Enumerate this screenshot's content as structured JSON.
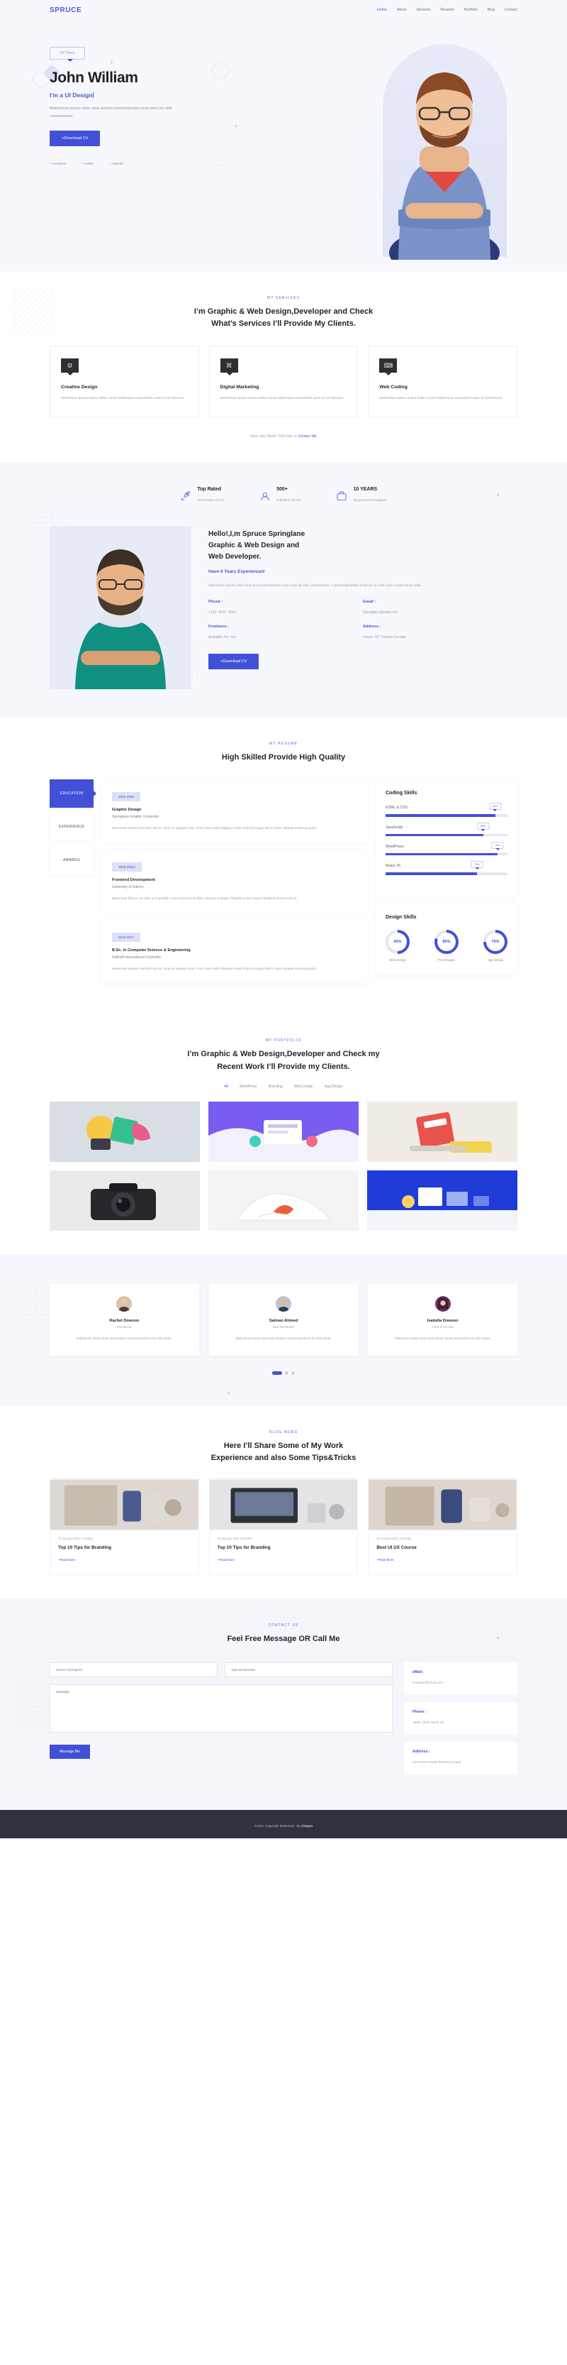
{
  "header": {
    "logo": "SPRUCE",
    "nav": [
      {
        "label": "Home",
        "active": true
      },
      {
        "label": "About",
        "active": false
      },
      {
        "label": "Services",
        "active": false
      },
      {
        "label": "Resume",
        "active": false
      },
      {
        "label": "Portfolio",
        "active": false
      },
      {
        "label": "Blog",
        "active": false
      },
      {
        "label": "Contact",
        "active": false
      }
    ]
  },
  "hero": {
    "badge": "Hi! There",
    "name": "John William",
    "role": "I'm a UI Design",
    "desc": "Maborisum ipsum dolor seat ameat consecteturetel seat more be elite consecteture.",
    "cta": "+Download CV",
    "socials": [
      "+ facebook",
      "+ twitter",
      "+ linkedin"
    ]
  },
  "services": {
    "tag": "MY SERVICES",
    "title_line1": "I’m Graphic & Web Design,Developer and Check",
    "title_line2": "What’s Services I’ll Provide My Clients.",
    "cards": [
      {
        "icon": "creative-design-icon",
        "glyph": "⚙",
        "title": "Creative Design",
        "desc": "Maborisum ipsum dosea ilelite conser Maborisum iesumdolor anim id est laborum"
      },
      {
        "icon": "digital-marketing-icon",
        "glyph": "⌘",
        "title": "Digital Marketing",
        "desc": "Maborisum ipsum dosea ilelite conser Maborisum iesumdolor anim id est laborum"
      },
      {
        "icon": "web-coding-icon",
        "glyph": "⌨",
        "title": "Web Coding",
        "desc": "Maborisum ipsum dosea ilelite conser Maborisum iesumdolor anim id est laborum"
      }
    ],
    "have_work_text": "Have any Work? Fell Free to",
    "have_work_link": "Contact Me"
  },
  "about": {
    "stats": [
      {
        "icon": "rocket-icon",
        "value": "Top Rated",
        "label": "Worldcalss UI-UX"
      },
      {
        "icon": "clients-icon",
        "value": "500+",
        "label": "Satisfied Clients"
      },
      {
        "icon": "experience-icon",
        "value": "10 YEARS",
        "label": "Experienced Designer"
      }
    ],
    "heading_line1": "Hello!,I,m Spruce Springlane",
    "heading_line2": "Graphic & Web Design and",
    "heading_line3": "Web Developer.",
    "sub": "Have 6 Years Experienced",
    "para": "Maborisum ipsum dolor seat ameconsecteturers seat more be elite consecteture. ContrarpopulabelLorelpsum is notili more consecteture elite.",
    "info": [
      {
        "label": "Phone :",
        "value": "+123- 4567- 8901"
      },
      {
        "label": "Email :",
        "value": "Springlane@mail.com"
      },
      {
        "label": "Freelance :",
        "value": "Avialable For You"
      },
      {
        "label": "Address :",
        "value": "House 201 Torento,Canada"
      }
    ],
    "cta": "+Download CV"
  },
  "resume": {
    "tag": "MY RESUME",
    "title": "High Skilled Provide High Quality",
    "tabs": [
      {
        "label": "EDUCATION",
        "active": true
      },
      {
        "label": "EXPERIENCE",
        "active": false
      },
      {
        "label": "AWARDS",
        "active": false
      }
    ],
    "items": [
      {
        "period": "2002-2006",
        "title": "Graphic Design",
        "org": "Springlean Graphic University",
        "desc": "Maecenas tempus faucibus rutrum. Duis eu aliquam urna. Proin vitae nulla tristique,ornare felis id,congue libero. Nam volutpat euismod quam."
      },
      {
        "period": "2008-20011",
        "title": "Frontend Development",
        "org": "University of Udemy",
        "desc": "Maecenas finibus nec sem ut imperdiet. Ut tincidunt est ac dolor aliquam sodales. Phasellus sed mauris hendrerit,laoreet sem in."
      },
      {
        "period": "2012-2017",
        "title": "B.Sc. in Computer Science & Engineering",
        "org": "Daffodil International University",
        "desc": "Maecenas tempus faucibus rutrum. Duis eu aliquam urna. Proin vitae nulla tristique,ornare felis id,congue libero. Nam volutpat euismod quam."
      }
    ],
    "coding_title": "Coding Skills",
    "coding": [
      {
        "label": "HTML & CSS",
        "value": 90,
        "display": "90%"
      },
      {
        "label": "JavaScript",
        "value": 80,
        "display": "80%"
      },
      {
        "label": "WordPress",
        "value": 92,
        "display": "92%"
      },
      {
        "label": "React JS",
        "value": 75,
        "display": "75%"
      }
    ],
    "design_title": "Design Skills",
    "design": [
      {
        "label": "Web Design",
        "value": 50,
        "display": "50%"
      },
      {
        "label": "Print Design",
        "value": 80,
        "display": "80%"
      },
      {
        "label": "App Design",
        "value": 75,
        "display": "75%"
      }
    ]
  },
  "portfolio": {
    "tag": "MY PORTFOLIO",
    "title_line1": "I’m Graphic & Web Design,Developer and Check my",
    "title_line2": "Recent Work I’ll Provide my Clients.",
    "filters": [
      {
        "label": "All",
        "active": true
      },
      {
        "label": "WordPress",
        "active": false
      },
      {
        "label": "Branding",
        "active": false
      },
      {
        "label": "Web Design",
        "active": false
      },
      {
        "label": "App Design",
        "active": false
      }
    ],
    "tiles": [
      {
        "name": "portfolio-tile-shapes",
        "bg": "#d9dde4"
      },
      {
        "name": "portfolio-tile-illustration",
        "bg": "#6b4fe0"
      },
      {
        "name": "portfolio-tile-calculator",
        "bg": "#f0ece7"
      },
      {
        "name": "portfolio-tile-camera",
        "bg": "#e9e9ea"
      },
      {
        "name": "portfolio-tile-fabric",
        "bg": "#f2f2f2"
      },
      {
        "name": "portfolio-tile-blue",
        "bg": "#1e3ad6"
      }
    ]
  },
  "testimonials": {
    "cards": [
      {
        "name": "Rachel Dowson",
        "role": "Freelancer",
        "text": "Maborisum ipsum dosn seat ameat consecteturerthore be elite ornas."
      },
      {
        "name": "Salman Ahmed",
        "role": "Next Developer",
        "text": "Maborisum ipsum dosn seat ameat consecteturerthore be elite ornas."
      },
      {
        "name": "Isabella Dowson",
        "role": "CEO of UX Lab",
        "text": "Maborisum ipsum dosn seat ameat consecteturerthore be elite ornas."
      }
    ]
  },
  "blog": {
    "tag": "BLOG NEWS",
    "title_line1": "Here I’ll Share Some of My Work",
    "title_line2": "Experience and also Some Tips&Tricks",
    "posts": [
      {
        "meta": "10 January 2021 | Sunday",
        "title": "Top 10 Tips for Branding",
        "more": "+Read More",
        "bg": "#ded8d4"
      },
      {
        "meta": "10 January 2021 | Sunday",
        "title": "Top 10 Tips for Branding",
        "more": "+Read More",
        "bg": "#e3e3e5"
      },
      {
        "meta": "10 January 2021 | Sunday",
        "title": "Best UI UX Course",
        "more": "+Read More",
        "bg": "#ddd6cf"
      }
    ]
  },
  "contact": {
    "tag": "CONTACT US",
    "title": "Feel Free Message OR Call Me",
    "name_value": "Spruce Springlane",
    "email_placeholder": "Type Email Here",
    "message_placeholder": "Message",
    "submit": "Message Me",
    "boxes": [
      {
        "label": "eMail :",
        "value": "example@email.com"
      },
      {
        "label": "Phone :",
        "value": "+880- 1234- 5678- 00"
      },
      {
        "label": "Address :",
        "value": "201 House Road,Toretno,Canada"
      }
    ]
  },
  "footer": {
    "text": "©2021 Copyright Reserved - By ",
    "brand": "Chayan"
  },
  "colors": {
    "accent": "#4250d8",
    "accent_light": "#5b68dd",
    "dark": "#23232e",
    "muted": "#9a9eac",
    "bg_light": "#f7f8fd",
    "footer_bg": "#2f3240"
  }
}
